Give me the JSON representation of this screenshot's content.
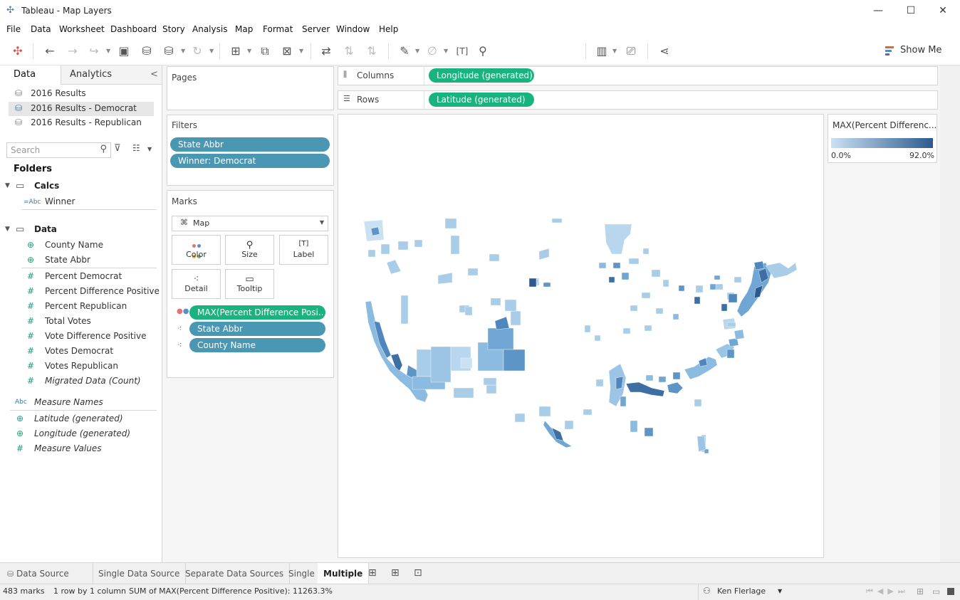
{
  "window": {
    "title": "Tableau - Map Layers",
    "minimize": "—",
    "maximize": "☐",
    "close": "✕"
  },
  "menu": [
    "File",
    "Data",
    "Worksheet",
    "Dashboard",
    "Story",
    "Analysis",
    "Map",
    "Format",
    "Server",
    "Window",
    "Help"
  ],
  "toolbar": {
    "show_me": "Show Me"
  },
  "leftpane": {
    "tab_data": "Data",
    "tab_analytics": "Analytics",
    "collapse": "<",
    "datasources": [
      "2016 Results",
      "2016 Results - Democrat",
      "2016 Results - Republican"
    ],
    "search_placeholder": "Search",
    "folders_title": "Folders",
    "folder_calcs": "Calcs",
    "folder_data": "Data",
    "calc_fields": [
      {
        "icon": "=Abc",
        "name": "Winner"
      }
    ],
    "dimensions": [
      {
        "icon": "globe",
        "name": "County Name"
      },
      {
        "icon": "globe",
        "name": "State Abbr"
      }
    ],
    "measures": [
      "Percent Democrat",
      "Percent Difference Positive",
      "Percent Republican",
      "Total Votes",
      "Vote Difference Positive",
      "Votes Democrat",
      "Votes Republican",
      "Migrated Data (Count)"
    ],
    "extra": [
      {
        "icon": "Abc",
        "name": "Measure Names"
      },
      {
        "icon": "globe",
        "name": "Latitude (generated)"
      },
      {
        "icon": "globe",
        "name": "Longitude (generated)"
      },
      {
        "icon": "#",
        "name": "Measure Values"
      }
    ]
  },
  "pages": {
    "title": "Pages"
  },
  "filters": {
    "title": "Filters",
    "pills": [
      "State Abbr",
      "Winner: Democrat"
    ]
  },
  "marks": {
    "title": "Marks",
    "type": "Map",
    "buttons": [
      "Color",
      "Size",
      "Label",
      "Detail",
      "Tooltip"
    ],
    "pills": [
      "MAX(Percent Difference Posi..",
      "State Abbr",
      "County Name"
    ]
  },
  "shelves": {
    "columns_label": "Columns",
    "columns_pill": "Longitude (generated)",
    "rows_label": "Rows",
    "rows_pill": "Latitude (generated)"
  },
  "legend": {
    "title": "MAX(Percent Differenc...",
    "min": "0.0%",
    "max": "92.0%",
    "color_low": "#c9e1f2",
    "color_high": "#2d5a8e"
  },
  "sheets": {
    "data_source": "Data Source",
    "tabs": [
      "Single Data Source",
      "Separate Data Sources",
      "Single",
      "Multiple"
    ],
    "active": "Multiple"
  },
  "status": {
    "marks": "483 marks",
    "dims": "1 row by 1 column",
    "sum": "SUM of MAX(Percent Difference Positive): 11263.3%",
    "user": "Ken Flerlage"
  }
}
